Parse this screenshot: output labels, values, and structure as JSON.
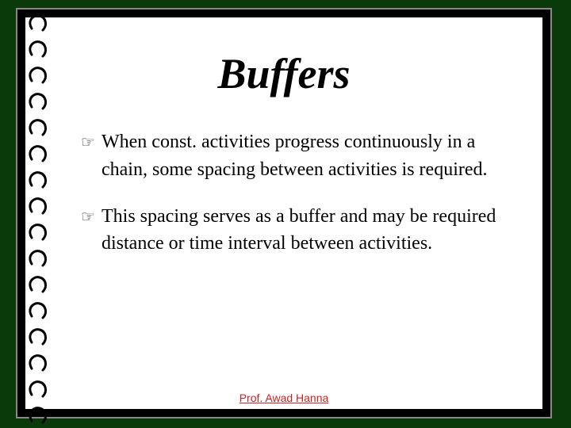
{
  "title": "Buffers",
  "bullets": [
    "When const. activities progress continuously in a chain, some spacing between activities is required.",
    "This spacing serves as a buffer and may be required distance or time interval between activities."
  ],
  "footer": "Prof. Awad Hanna",
  "spiral": {
    "count": 16,
    "spacing": 33
  },
  "colors": {
    "frame_bg": "#0a3a0a",
    "page_bg": "#ffffff",
    "outer_bg": "#000000",
    "footer": "#d02020"
  }
}
